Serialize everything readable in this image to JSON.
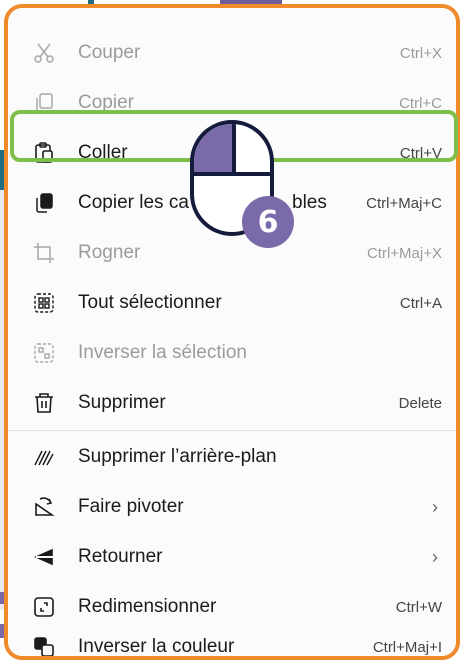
{
  "colors": {
    "menu_border": "#f08a2a",
    "highlight_border": "#7cc04b",
    "mouse_outline": "#151b3c",
    "accent_purple": "#7a6aa9"
  },
  "menu": {
    "items": [
      {
        "label": "Couper",
        "shortcut": "Ctrl+X",
        "icon": "scissors-icon",
        "disabled": true
      },
      {
        "label": "Copier",
        "shortcut": "Ctrl+C",
        "icon": "copy-icon",
        "disabled": true
      },
      {
        "label": "Coller",
        "shortcut": "Ctrl+V",
        "icon": "paste-icon",
        "disabled": false
      },
      {
        "label": "Copier les ca",
        "label_tail": "bles",
        "shortcut": "Ctrl+Maj+C",
        "icon": "copy-visible-icon",
        "disabled": false
      },
      {
        "label": "Rogner",
        "shortcut": "Ctrl+Maj+X",
        "icon": "crop-icon",
        "disabled": true
      },
      {
        "label": "Tout sélectionner",
        "shortcut": "Ctrl+A",
        "icon": "select-all-icon",
        "disabled": false
      },
      {
        "label": "Inverser la sélection",
        "shortcut": "",
        "icon": "invert-selection-icon",
        "disabled": true
      },
      {
        "label": "Supprimer",
        "shortcut": "Delete",
        "icon": "trash-icon",
        "disabled": false
      },
      {
        "label": "Supprimer l’arrière-plan",
        "shortcut": "",
        "icon": "remove-background-icon",
        "disabled": false
      },
      {
        "label": "Faire pivoter",
        "shortcut": "",
        "icon": "rotate-icon",
        "disabled": false,
        "submenu": true,
        "chevron": "›"
      },
      {
        "label": "Retourner",
        "shortcut": "",
        "icon": "flip-icon",
        "disabled": false,
        "submenu": true,
        "chevron": "›"
      },
      {
        "label": "Redimensionner",
        "shortcut": "Ctrl+W",
        "icon": "resize-icon",
        "disabled": false
      },
      {
        "label": "Inverser la couleur",
        "shortcut": "Ctrl+Maj+I",
        "icon": "invert-color-icon",
        "disabled": false
      }
    ]
  },
  "annotation": {
    "step_number": "6",
    "mouse_icon": "mouse-left-click-icon",
    "highlighted_item": "Coller"
  }
}
